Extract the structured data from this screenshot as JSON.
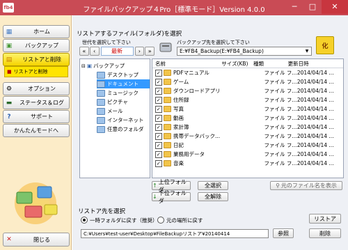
{
  "window": {
    "title": "ファイルバックアップ４Pro［標準モード］Version 4.0.0",
    "app_badge": "fb4",
    "min": "─",
    "max": "□",
    "close": "✕"
  },
  "sidebar": {
    "home": "ホーム",
    "backup": "バックアップ",
    "restore_delete": "リストアと削除",
    "sub_restore_delete": "リストアと削除",
    "options": "オプション",
    "status_log": "ステータス＆ログ",
    "support": "サポート",
    "easy_mode": "かんたんモードへ",
    "close": "閉じる"
  },
  "select_group": {
    "title": "リストアするファイル(フォルダ)を選択",
    "gen_label": "世代を選択して下さい",
    "gen_value": "最新",
    "nav_first": "«",
    "nav_prev": "‹",
    "nav_next": "›",
    "nav_last": "»",
    "dest_label": "バックアップ先を選択して下さい",
    "dest_value": "E:¥FB4_Backup(E:¥FB4_Backup)",
    "icon_btn_label": "化"
  },
  "tree": {
    "root": "バックアップ",
    "items": [
      "デスクトップ",
      "ドキュメント",
      "ミュージック",
      "ピクチャ",
      "メール",
      "インターネット",
      "任意のフォルダ"
    ],
    "selected_index": 1
  },
  "file_list": {
    "headers": {
      "name": "名前",
      "size": "サイズ(KB)",
      "type": "種類",
      "date": "更新日時"
    },
    "rows": [
      {
        "name": "PDFマニュアル",
        "type": "ファイル フ...",
        "date": "2014/04/14 ..."
      },
      {
        "name": "ゲーム",
        "type": "ファイル フ...",
        "date": "2014/04/14 ..."
      },
      {
        "name": "ダウンロードアプリ",
        "type": "ファイル フ...",
        "date": "2014/04/14 ..."
      },
      {
        "name": "住所録",
        "type": "ファイル フ...",
        "date": "2014/04/14 ..."
      },
      {
        "name": "写真",
        "type": "ファイル フ...",
        "date": "2014/04/14 ..."
      },
      {
        "name": "動画",
        "type": "ファイル フ...",
        "date": "2014/04/14 ..."
      },
      {
        "name": "家計簿",
        "type": "ファイル フ...",
        "date": "2014/04/14 ..."
      },
      {
        "name": "携帯データバック...",
        "type": "ファイル フ...",
        "date": "2014/04/14 ..."
      },
      {
        "name": "日記",
        "type": "ファイル フ...",
        "date": "2014/04/14 ..."
      },
      {
        "name": "業務用データ",
        "type": "ファイル フ...",
        "date": "2014/04/14 ..."
      },
      {
        "name": "音楽",
        "type": "ファイル フ...",
        "date": "2014/04/14 ..."
      }
    ]
  },
  "actions": {
    "up_folder": "上位フォルダ",
    "down_folder": "下位フォルダ",
    "select_all": "全選択",
    "deselect_all": "全解除",
    "show_original": "元のファイル名を表示"
  },
  "restore_target": {
    "title": "リストア先を選択",
    "opt_temp": "一時フォルダに戻す（推奨）",
    "opt_original": "元の場所に戻す",
    "selected": "temp",
    "path": "C:¥Users¥test-user¥Desktop¥FileBackupリストア¥20140414",
    "browse": "参照",
    "restore": "リストア",
    "delete": "削除"
  }
}
